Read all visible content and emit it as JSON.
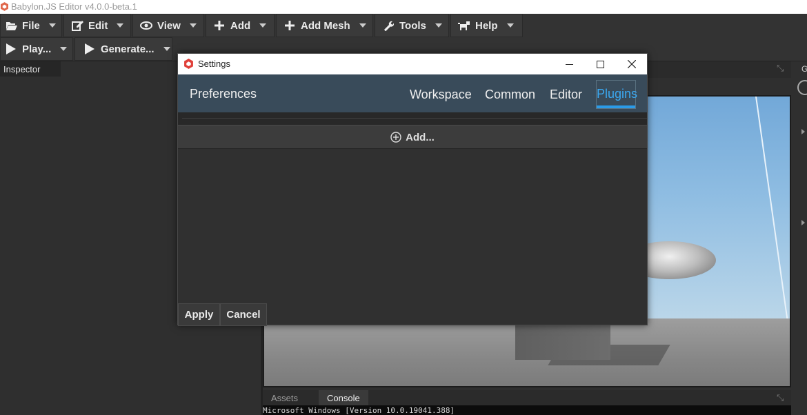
{
  "app": {
    "title": "Babylon.JS Editor v4.0.0-beta.1"
  },
  "toolbar": {
    "row1": [
      {
        "label": "File",
        "icon": "folder-open-icon"
      },
      {
        "label": "Edit",
        "icon": "edit-icon"
      },
      {
        "label": "View",
        "icon": "eye-icon"
      },
      {
        "label": "Add",
        "icon": "plus-icon"
      },
      {
        "label": "Add Mesh",
        "icon": "plus-icon"
      },
      {
        "label": "Tools",
        "icon": "wrench-icon"
      },
      {
        "label": "Help",
        "icon": "dog-icon"
      }
    ],
    "row2": [
      {
        "label": "Play...",
        "icon": "play-icon"
      },
      {
        "label": "Generate...",
        "icon": "play-icon"
      }
    ]
  },
  "left_panel": {
    "tab_label": "Inspector"
  },
  "right_panel": {
    "tab_label_partial": "G"
  },
  "bottom_panel": {
    "tabs": [
      {
        "label": "Assets",
        "active": false
      },
      {
        "label": "Console",
        "active": true
      }
    ],
    "console_line": "Microsoft Windows [Version 10.0.19041.388]"
  },
  "dialog": {
    "title": "Settings",
    "heading": "Preferences",
    "tabs": [
      {
        "label": "Workspace",
        "active": false
      },
      {
        "label": "Common",
        "active": false
      },
      {
        "label": "Editor",
        "active": false
      },
      {
        "label": "Plugins",
        "active": true
      }
    ],
    "add_label": "Add...",
    "apply_label": "Apply",
    "cancel_label": "Cancel"
  },
  "colors": {
    "dialog_header": "#394b5a",
    "active_tab": "#3aa8f0",
    "toolbar_bg": "#333333",
    "panel_bg": "#2f2f2f"
  }
}
